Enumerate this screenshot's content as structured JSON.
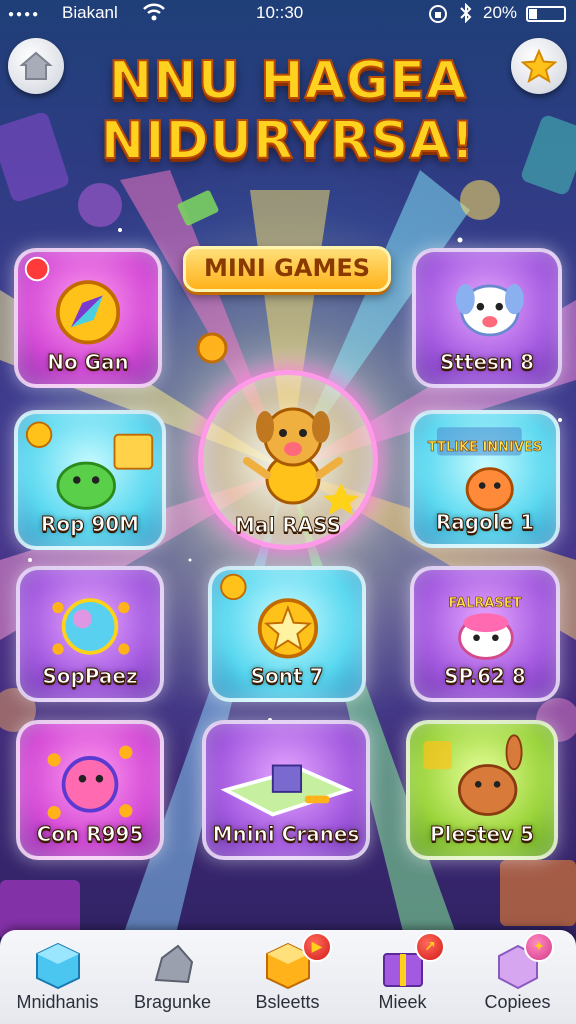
{
  "status_bar": {
    "carrier": "Biakanl",
    "time": "10::30",
    "battery": "20%"
  },
  "header": {
    "title_line1": "NNU HAGEA",
    "title_line2": "NIDURYRSA!"
  },
  "banner": {
    "label": "MINI GAMES"
  },
  "tiles": [
    {
      "label": "No Gan"
    },
    {
      "label": "Sttesn 8"
    },
    {
      "label": "Rop 90M"
    },
    {
      "label": "Mal RASS"
    },
    {
      "label": "Ragole 1",
      "caption": "TTLIKE INNIVES"
    },
    {
      "label": "SopPaez"
    },
    {
      "label": "Sont 7"
    },
    {
      "label": "SP.62 8",
      "caption": "FALRASET"
    },
    {
      "label": "Con R995"
    },
    {
      "label": "Mnini Cranes"
    },
    {
      "label": "Plestev 5"
    }
  ],
  "tabbar": {
    "tabs": [
      {
        "label": "Mnidhanis",
        "icon": "blue-cube-icon"
      },
      {
        "label": "Bragunke",
        "icon": "gray-rock-icon"
      },
      {
        "label": "Bsleetts",
        "icon": "orange-cube-icon"
      },
      {
        "label": "Mieek",
        "icon": "purple-gift-icon"
      },
      {
        "label": "Copiees",
        "icon": "lilac-cube-icon"
      }
    ]
  },
  "colors": {
    "title": "#ffd21f",
    "banner": "#ffb21a",
    "tile_pink": "#d44ad6",
    "tile_cyan": "#5ad8f0",
    "tile_purple": "#a45ae0",
    "tile_green": "#9ad43a"
  }
}
